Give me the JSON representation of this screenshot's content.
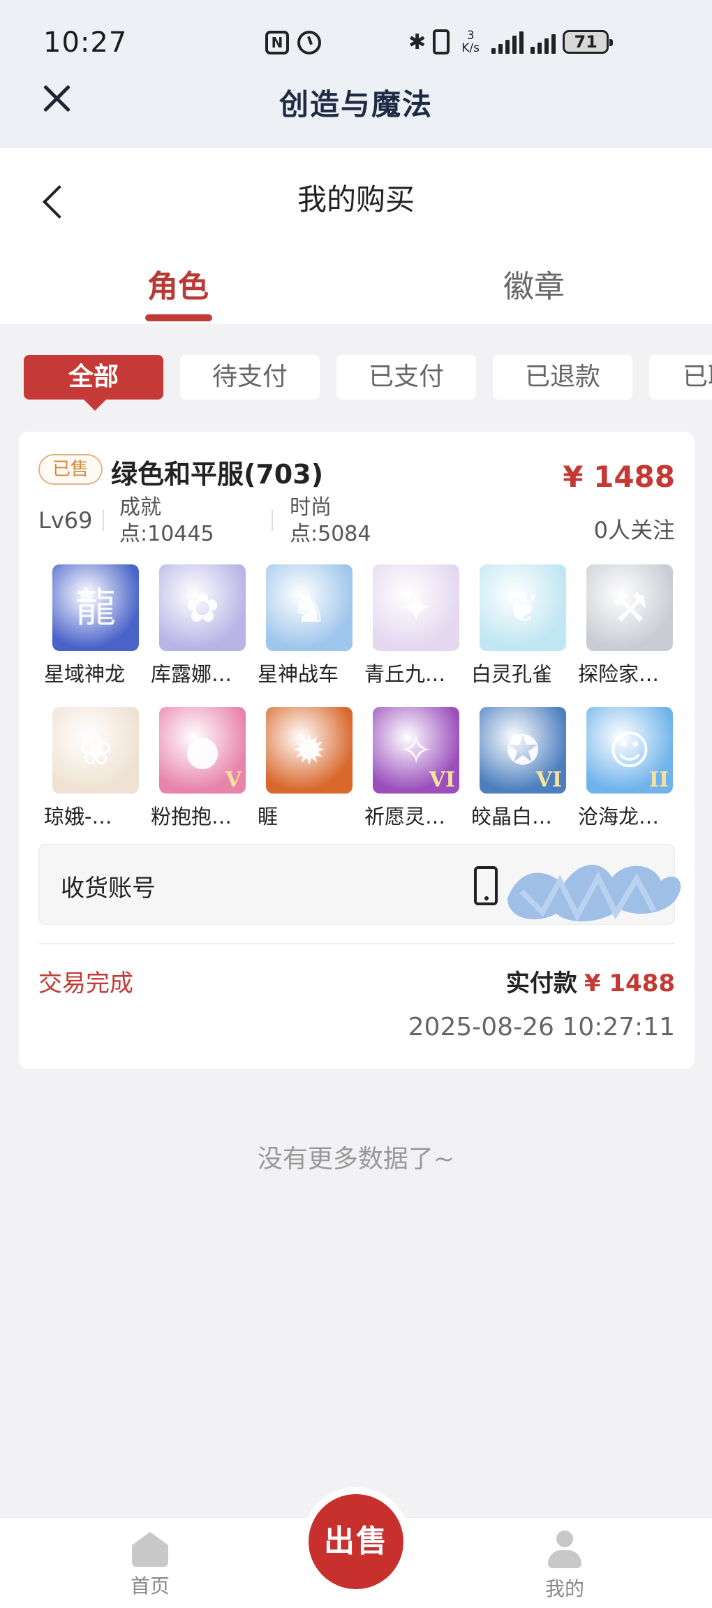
{
  "status_bar": {
    "time": "10:27",
    "net_speed_value": "3",
    "net_speed_unit": "K/s",
    "battery": "71"
  },
  "miniapp": {
    "title": "创造与魔法"
  },
  "page": {
    "title": "我的购买",
    "tabs": [
      {
        "label": "角色",
        "active": true
      },
      {
        "label": "徽章",
        "active": false
      }
    ]
  },
  "filters": [
    {
      "label": "全部",
      "active": true
    },
    {
      "label": "待支付",
      "active": false
    },
    {
      "label": "已支付",
      "active": false
    },
    {
      "label": "已退款",
      "active": false
    },
    {
      "label": "已取",
      "active": false
    }
  ],
  "order": {
    "badge": "已售",
    "name": "绿色和平服(703)",
    "price": "¥ 1488",
    "level": "Lv69",
    "achievement_label": "成就",
    "achievement_value": "点:10445",
    "fashion_label": "时尚",
    "fashion_value": "点:5084",
    "followers": "0人关注",
    "characters": [
      {
        "label": "星域神龙",
        "icon": "dragon-icon",
        "color": "#4a63c9"
      },
      {
        "label": "库露娜…",
        "icon": "girl-icon",
        "color": "#b8b4e6"
      },
      {
        "label": "星神战车",
        "icon": "horse-icon",
        "color": "#9fc6ec"
      },
      {
        "label": "青丘九…",
        "icon": "fox-icon",
        "color": "#e3d8f0"
      },
      {
        "label": "白灵孔雀",
        "icon": "peacock-icon",
        "color": "#bfe6f2"
      },
      {
        "label": "探险家…",
        "icon": "shovel-icon",
        "color": "#c9ccd3"
      },
      {
        "label": "琼娥-…",
        "icon": "lady-icon",
        "color": "#efe2d2"
      },
      {
        "label": "粉抱抱…",
        "icon": "bear-icon",
        "color": "#e884ab",
        "tier": "V"
      },
      {
        "label": "睚",
        "icon": "beast-icon",
        "color": "#d8682c"
      },
      {
        "label": "祈愿灵…",
        "icon": "eagle-icon",
        "color": "#9a4fbc",
        "tier": "VI"
      },
      {
        "label": "皎晶白…",
        "icon": "tiger-icon",
        "color": "#4d7fbf",
        "tier": "VI"
      },
      {
        "label": "沧海龙…",
        "icon": "boy-icon",
        "color": "#6fb3ea",
        "tier": "II"
      }
    ],
    "receive_label": "收货账号",
    "status": "交易完成",
    "paid_label": "实付款",
    "paid_amount": "¥ 1488",
    "time": "2025-08-26 10:27:11"
  },
  "no_more": "没有更多数据了~",
  "bottom_nav": {
    "home": "首页",
    "sell": "出售",
    "mine": "我的"
  },
  "colors": {
    "accent": "#c53a36",
    "background": "#f2f2f4"
  }
}
